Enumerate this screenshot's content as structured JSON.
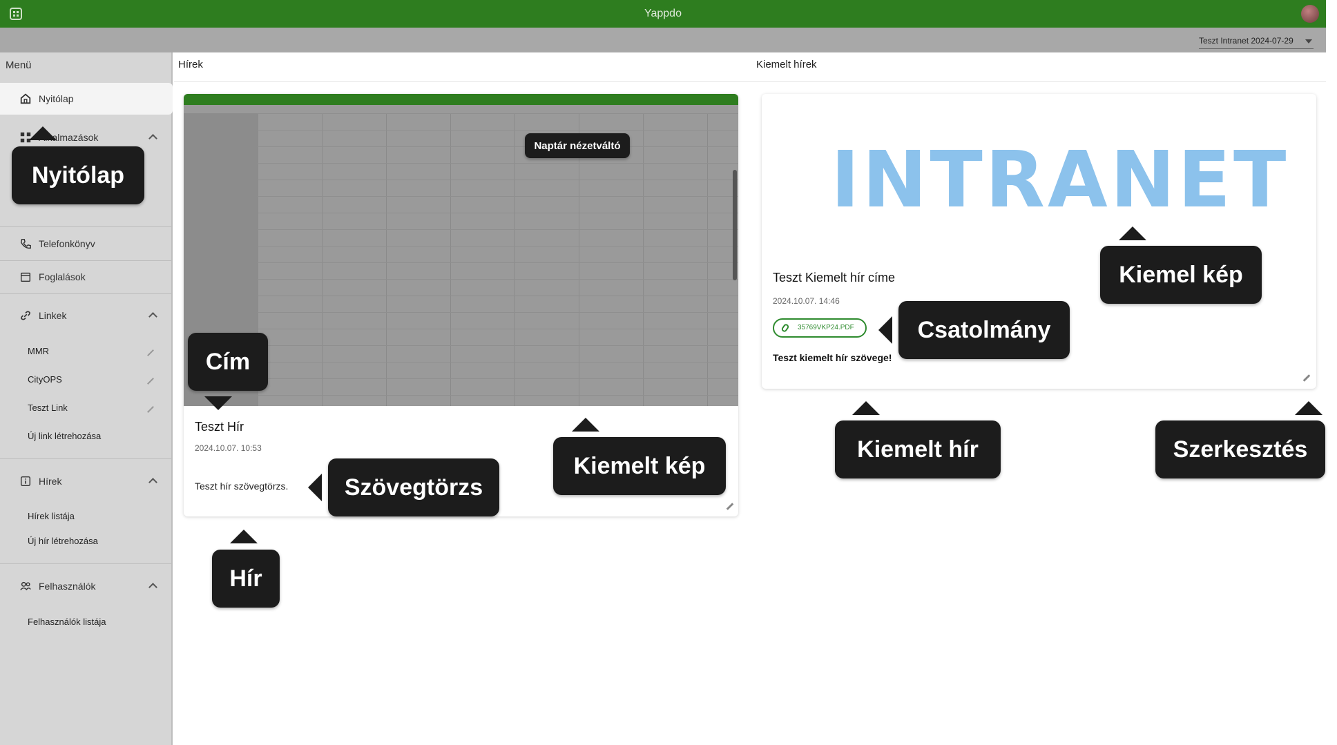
{
  "app": {
    "title": "Yappdo"
  },
  "subbar": {
    "instance_selector": "Teszt Intranet 2024-07-29"
  },
  "sidebar": {
    "menu_title": "Menü",
    "items": [
      {
        "label": "Nyitólap",
        "icon": "home-icon"
      },
      {
        "label": "Alkalmazások",
        "icon": "apps-icon"
      },
      {
        "label": "Telefonkönyv",
        "icon": "phone-icon"
      },
      {
        "label": "Foglalások",
        "icon": "calendar-icon"
      },
      {
        "label": "Linkek",
        "icon": "link-icon"
      },
      {
        "label": "Hírek",
        "icon": "info-icon"
      },
      {
        "label": "Felhasználók",
        "icon": "users-icon"
      }
    ],
    "links_sub": [
      "MMR",
      "CityOPS",
      "Teszt Link",
      "Új link létrehozása"
    ],
    "news_sub": [
      "Hírek listája",
      "Új hír létrehozása"
    ],
    "users_sub": [
      "Felhasználók listája"
    ]
  },
  "main": {
    "news_section_title": "Hírek",
    "featured_section_title": "Kiemelt hírek",
    "news_card": {
      "title": "Teszt Hír",
      "date": "2024.10.07. 10:53",
      "body": "Teszt hír szövegtörzs."
    },
    "featured_card": {
      "image_text": "INTRANET",
      "title": "Teszt Kiemelt hír címe",
      "date": "2024.10.07. 14:46",
      "attachment": "35769VKP24.PDF",
      "body": "Teszt kiemelt hír szövege!"
    }
  },
  "callouts": {
    "nyitolap": "Nyitólap",
    "naptar": "Naptár nézetváltó",
    "cim": "Cím",
    "kiemelt_kep_left": "Kiemelt kép",
    "szovegtorzs": "Szövegtörzs",
    "hir": "Hír",
    "kiemel_kep": "Kiemel kép",
    "csatolmany": "Csatolmány",
    "kiemelt_hir": "Kiemelt hír",
    "szerkesztes": "Szerkesztés"
  }
}
